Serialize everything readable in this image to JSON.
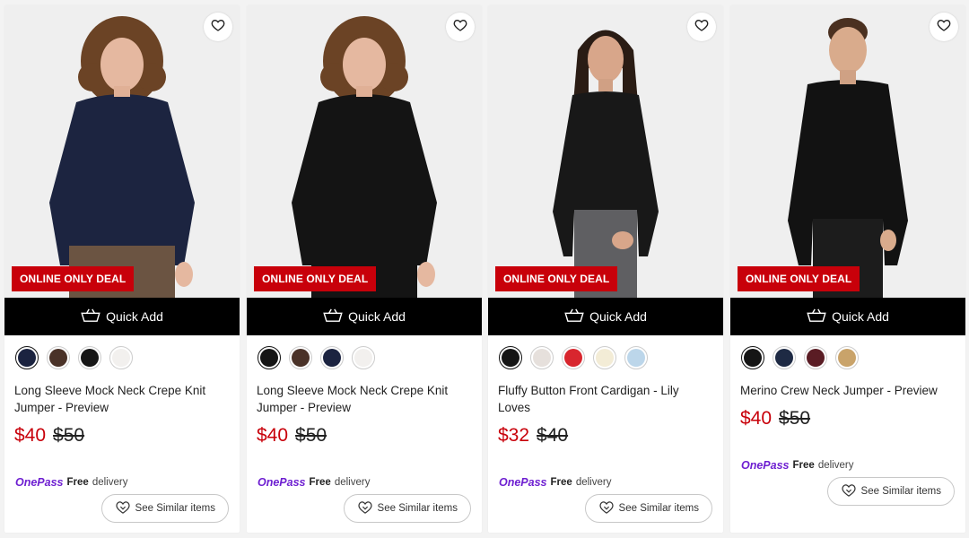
{
  "products": [
    {
      "title": "Long Sleeve Mock Neck Crepe Knit Jumper - Preview",
      "price_now": "$40",
      "price_was": "$50",
      "deal": "ONLINE ONLY DEAL",
      "quick_add": "Quick Add",
      "swatches": [
        "#1b2340",
        "#4a3228",
        "#151515",
        "#f2f0ee"
      ],
      "selected_swatch": 0,
      "delivery_brand": "OnePass",
      "delivery_free": "Free",
      "delivery_word": "delivery",
      "similar": "See Similar items",
      "garment_color": "#1c2440",
      "pants_color": "#6b5442",
      "model": "woman-curly"
    },
    {
      "title": "Long Sleeve Mock Neck Crepe Knit Jumper - Preview",
      "price_now": "$40",
      "price_was": "$50",
      "deal": "ONLINE ONLY DEAL",
      "quick_add": "Quick Add",
      "swatches": [
        "#151515",
        "#4a3228",
        "#1b2340",
        "#f2f0ee"
      ],
      "selected_swatch": 0,
      "delivery_brand": "OnePass",
      "delivery_free": "Free",
      "delivery_word": "delivery",
      "similar": "See Similar items",
      "garment_color": "#141414",
      "pants_color": "#141414",
      "model": "woman-curly"
    },
    {
      "title": "Fluffy Button Front Cardigan - Lily Loves",
      "price_now": "$32",
      "price_was": "$40",
      "deal": "ONLINE ONLY DEAL",
      "quick_add": "Quick Add",
      "swatches": [
        "#151515",
        "#e6e0dc",
        "#d8262e",
        "#f3ecd6",
        "#bcd6ea"
      ],
      "selected_swatch": 0,
      "delivery_brand": "OnePass",
      "delivery_free": "Free",
      "delivery_word": "delivery",
      "similar": "See Similar items",
      "garment_color": "#181818",
      "pants_color": "#5f5f62",
      "model": "woman-long"
    },
    {
      "title": "Merino Crew Neck Jumper - Preview",
      "price_now": "$40",
      "price_was": "$50",
      "deal": "ONLINE ONLY DEAL",
      "quick_add": "Quick Add",
      "swatches": [
        "#151515",
        "#1e2a44",
        "#5a1c24",
        "#c9a36a"
      ],
      "selected_swatch": 0,
      "delivery_brand": "OnePass",
      "delivery_free": "Free",
      "delivery_word": "delivery",
      "similar": "See Similar items",
      "garment_color": "#121212",
      "pants_color": "#1c1c1c",
      "model": "man"
    }
  ]
}
